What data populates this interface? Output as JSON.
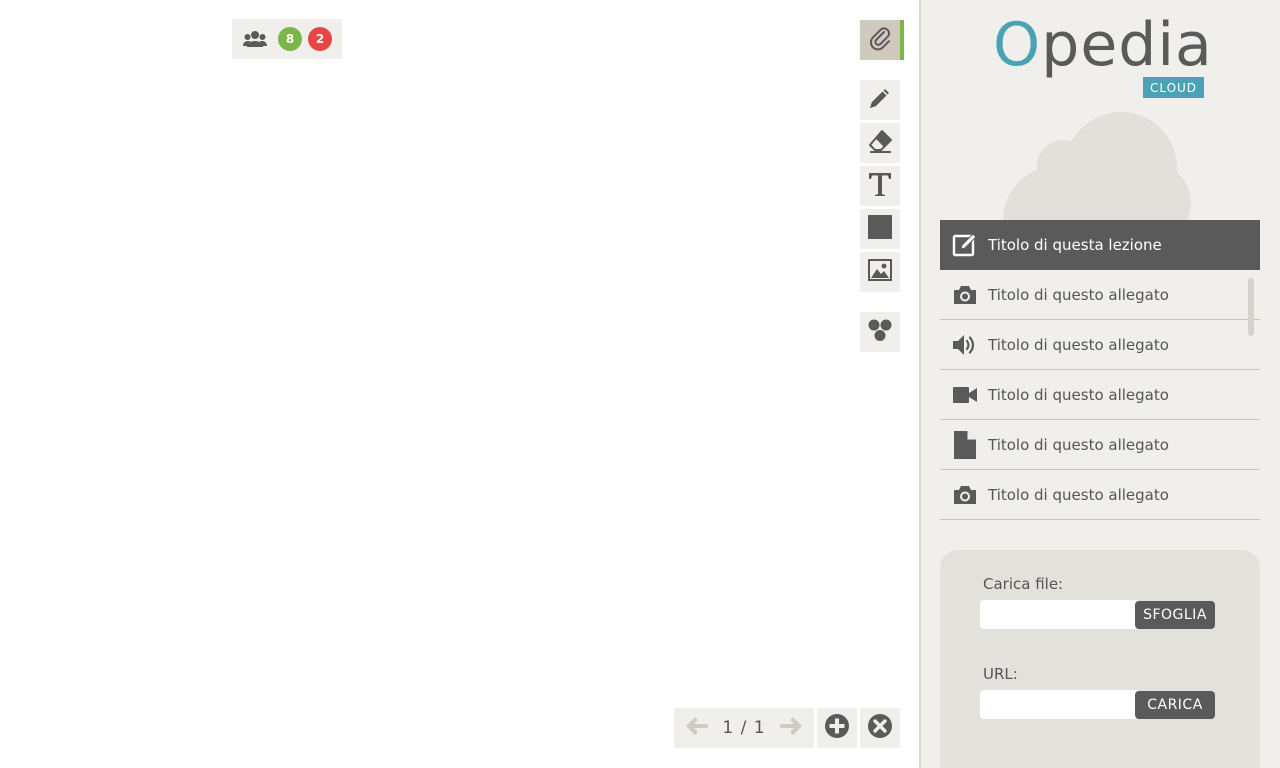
{
  "users": {
    "online_count": "8",
    "offline_count": "2"
  },
  "pager": {
    "indicator": "1 / 1"
  },
  "brand": {
    "logo_o": "O",
    "logo_rest": "pedia",
    "tag": "CLOUD"
  },
  "lesson": {
    "title": "Titolo di questa lezione"
  },
  "attachments": [
    {
      "icon": "camera-icon",
      "label": "Titolo di questo allegato"
    },
    {
      "icon": "speaker-icon",
      "label": "Titolo di questo allegato"
    },
    {
      "icon": "video-icon",
      "label": "Titolo di questo allegato"
    },
    {
      "icon": "file-icon",
      "label": "Titolo di questo allegato"
    },
    {
      "icon": "camera-icon",
      "label": "Titolo di questo allegato"
    }
  ],
  "upload": {
    "file_label": "Carica file:",
    "browse_button": "SFOGLIA",
    "url_label": "URL:",
    "load_button": "CARICA"
  },
  "colors": {
    "accent": "#4aa3b5",
    "green": "#7ab648",
    "red": "#e84545",
    "dark": "#5a5a5a"
  }
}
